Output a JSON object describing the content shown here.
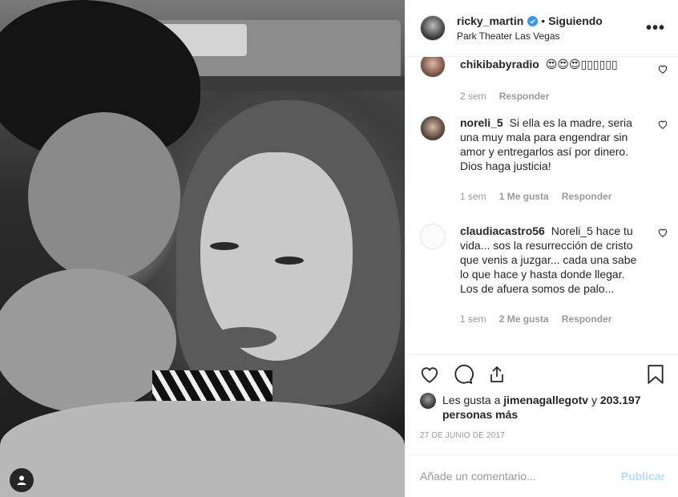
{
  "post": {
    "username": "ricky_martin",
    "follow_status": "Siguiendo",
    "separator": "•",
    "location": "Park Theater Las Vegas",
    "more_label": "•••"
  },
  "comments": [
    {
      "username": "chikibabyradio",
      "text": "😍😍😍▯▯▯▯▯▯",
      "time": "2 sem",
      "likes": "",
      "reply": "Responder"
    },
    {
      "username": "noreli_5",
      "text": "Si ella es la madre, seria una muy mala para engendrar sin amor y entregarlos así por dinero. Dios haga justicia!",
      "time": "1 sem",
      "likes": "1 Me gusta",
      "reply": "Responder"
    },
    {
      "username": "claudiacastro56",
      "text": "Noreli_5 hace tu vida... sos la resurrección de cristo que venis a juzgar... cada una sabe lo que hace y hasta donde llegar. Los de afuera somos de palo...",
      "time": "1 sem",
      "likes": "2 Me gusta",
      "reply": "Responder"
    }
  ],
  "likes": {
    "prefix": "Les gusta a ",
    "first_user": "jimenagallegotv",
    "connector": " y ",
    "count": "203.197 personas más"
  },
  "date": "27 DE JUNIO DE 2017",
  "add_comment": {
    "placeholder": "Añade un comentario...",
    "publish_label": "Publicar"
  },
  "icons": [
    "like-icon",
    "comment-icon",
    "share-icon",
    "save-icon",
    "user-tag-icon",
    "verified-icon",
    "heart-small-icon"
  ],
  "colors": {
    "verified": "#3897f0",
    "publish_disabled": "#b3dbff",
    "meta": "#999999"
  }
}
